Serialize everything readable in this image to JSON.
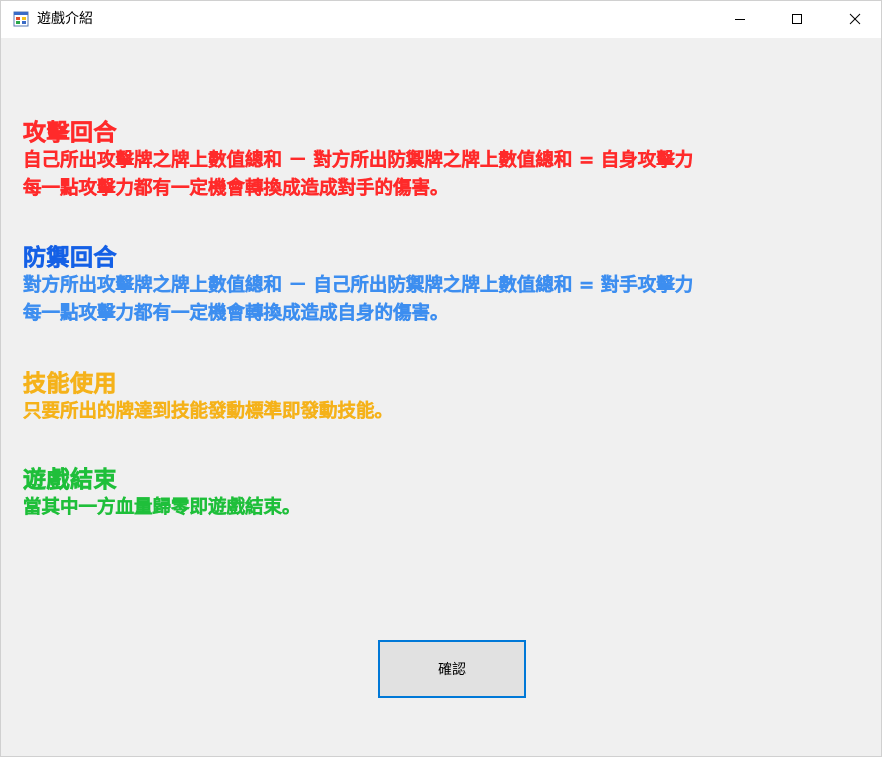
{
  "window": {
    "title": "遊戲介紹",
    "icon": "app-form-icon",
    "controls": [
      "minimize-icon",
      "maximize-icon",
      "close-icon"
    ]
  },
  "sections": [
    {
      "heading": "攻擊回合",
      "color": "#ff2a2a",
      "lines": [
        "自己所出攻擊牌之牌上數值總和 － 對方所出防禦牌之牌上數值總和 = 自身攻擊力",
        "每一點攻擊力都有一定機會轉換成造成對手的傷害。"
      ]
    },
    {
      "heading": "防禦回合",
      "heading_color": "#1460e6",
      "color": "#3d8ef0",
      "lines": [
        "對方所出攻擊牌之牌上數值總和 － 自己所出防禦牌之牌上數值總和 = 對手攻擊力",
        "每一點攻擊力都有一定機會轉換成造成自身的傷害。"
      ]
    },
    {
      "heading": "技能使用",
      "color": "#f5b21a",
      "lines": [
        "只要所出的牌達到技能發動標準即發動技能。"
      ]
    },
    {
      "heading": "遊戲結束",
      "color": "#1fbf3a",
      "lines": [
        "當其中一方血量歸零即遊戲結束。"
      ]
    }
  ],
  "confirm_button": {
    "label": "確認",
    "border_color": "#0078d7"
  }
}
